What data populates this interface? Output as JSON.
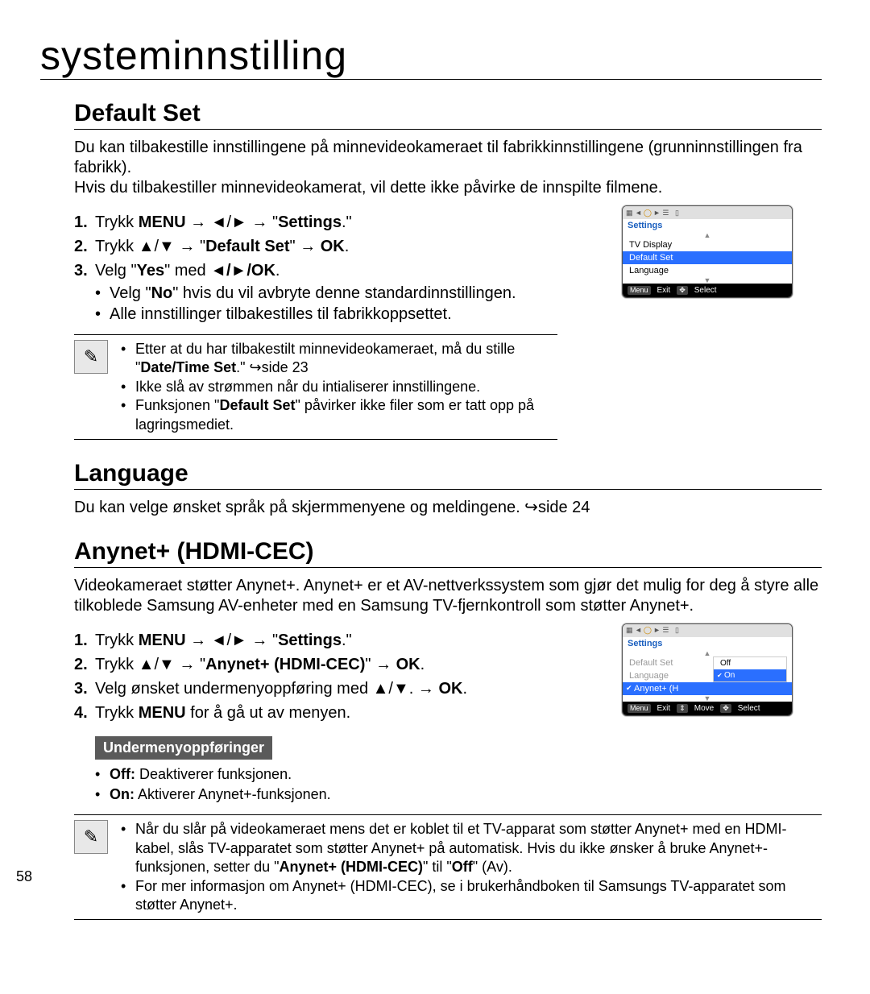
{
  "page_title": "systeminnstilling",
  "page_number": "58",
  "default_set": {
    "heading": "Default Set",
    "p1": "Du kan tilbakestille innstillingene på minnevideokameraet til fabrikkinnstillingene (grunninnstillingen fra fabrikk).",
    "p2": "Hvis du tilbakestiller minnevideokamerat, vil dette ikke påvirke de innspilte filmene.",
    "steps": {
      "s1_pre": "Trykk ",
      "s1_b1": "MENU",
      "s1_mid": " → ◄/► → \"",
      "s1_b2": "Settings",
      "s1_end": ".\"",
      "s2_pre": "Trykk ▲/▼ → \"",
      "s2_b1": "Default Set",
      "s2_mid": "\" → ",
      "s2_b2": "OK",
      "s2_end": ".",
      "s3_pre": "Velg \"",
      "s3_b1": "Yes",
      "s3_mid": "\" med ",
      "s3_b2": "◄/►/OK",
      "s3_end": ".",
      "sub1_pre": "Velg \"",
      "sub1_b": "No",
      "sub1_end": "\" hvis du vil avbryte denne standardinnstillingen.",
      "sub2": "Alle innstillinger tilbakestilles til fabrikkoppsettet."
    },
    "note": {
      "n1_pre": "Etter at du har tilbakestilt minnevideokameraet, må du stille \"",
      "n1_b": "Date/Time Set",
      "n1_end": ".\" ↪side 23",
      "n2": "Ikke slå av strømmen når du intialiserer innstillingene.",
      "n3_pre": "Funksjonen \"",
      "n3_b": "Default Set",
      "n3_end": "\" påvirker ikke filer som er tatt opp på lagringsmediet."
    }
  },
  "language": {
    "heading": "Language",
    "p": "Du kan velge ønsket språk på skjermmenyene og meldingene. ↪side 24"
  },
  "anynet": {
    "heading": "Anynet+ (HDMI-CEC)",
    "p": "Videokameraet støtter Anynet+. Anynet+ er et AV-nettverkssystem som gjør det mulig for deg å styre alle tilkoblede Samsung AV-enheter med en Samsung TV-fjernkontroll som støtter Anynet+.",
    "steps": {
      "s1_pre": "Trykk ",
      "s1_b1": "MENU",
      "s1_mid": " → ◄/► → \"",
      "s1_b2": "Settings",
      "s1_end": ".\"",
      "s2_pre": "Trykk ▲/▼ → \"",
      "s2_b1": "Anynet+ (HDMI-CEC)",
      "s2_mid": "\" → ",
      "s2_b2": "OK",
      "s2_end": ".",
      "s3_pre": "Velg ønsket undermenyoppføring med ▲/▼. → ",
      "s3_b": "OK",
      "s3_end": ".",
      "s4_pre": "Trykk ",
      "s4_b": "MENU",
      "s4_end": " for å gå ut av menyen."
    },
    "submenu_label": "Undermenyoppføringer",
    "submenu": {
      "off_b": "Off:",
      "off": " Deaktiverer funksjonen.",
      "on_b": "On:",
      "on": " Aktiverer Anynet+-funksjonen."
    },
    "note": {
      "n1_pre": "Når du slår på videokameraet mens det er koblet til et TV-apparat som støtter Anynet+ med en HDMI-kabel, slås TV-apparatet som støtter Anynet+ på automatisk. Hvis du ikke ønsker å bruke Anynet+-funksjonen, setter du \"",
      "n1_b1": "Anynet+ (HDMI-CEC)",
      "n1_mid": "\" til \"",
      "n1_b2": "Off",
      "n1_end": "\" (Av).",
      "n2": "For mer informasjon om Anynet+ (HDMI-CEC), se i brukerhåndboken til Samsungs TV-apparatet som støtter Anynet+."
    }
  },
  "screen1": {
    "title": "Settings",
    "items": [
      "TV Display",
      "Default Set",
      "Language"
    ],
    "footer_menu": "Menu",
    "footer_exit": "Exit",
    "footer_select": "Select"
  },
  "screen2": {
    "title": "Settings",
    "items": [
      "Default Set",
      "Language",
      "Anynet+ (H"
    ],
    "off": "Off",
    "on": "On",
    "footer_menu": "Menu",
    "footer_exit": "Exit",
    "footer_move": "Move",
    "footer_select": "Select"
  }
}
